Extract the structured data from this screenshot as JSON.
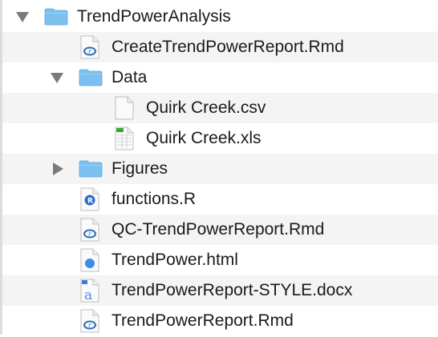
{
  "items": [
    {
      "name": "TrendPowerAnalysis",
      "type": "folder",
      "level": 0,
      "expanded": true
    },
    {
      "name": "CreateTrendPowerReport.Rmd",
      "type": "rmd",
      "level": 1
    },
    {
      "name": "Data",
      "type": "folder",
      "level": 1,
      "expanded": true
    },
    {
      "name": "Quirk Creek.csv",
      "type": "csv",
      "level": 2
    },
    {
      "name": "Quirk Creek.xls",
      "type": "xls",
      "level": 2
    },
    {
      "name": "Figures",
      "type": "folder",
      "level": 1,
      "expanded": false
    },
    {
      "name": "functions.R",
      "type": "r",
      "level": 1
    },
    {
      "name": "QC-TrendPowerReport.Rmd",
      "type": "rmd",
      "level": 1
    },
    {
      "name": "TrendPower.html",
      "type": "html",
      "level": 1
    },
    {
      "name": "TrendPowerReport-STYLE.docx",
      "type": "docx",
      "level": 1
    },
    {
      "name": "TrendPowerReport.Rmd",
      "type": "rmd",
      "level": 1
    }
  ],
  "colors": {
    "folder": "#7cc0f0",
    "stripe": "#f4f4f4",
    "disclosure": "#7a7a7a"
  }
}
